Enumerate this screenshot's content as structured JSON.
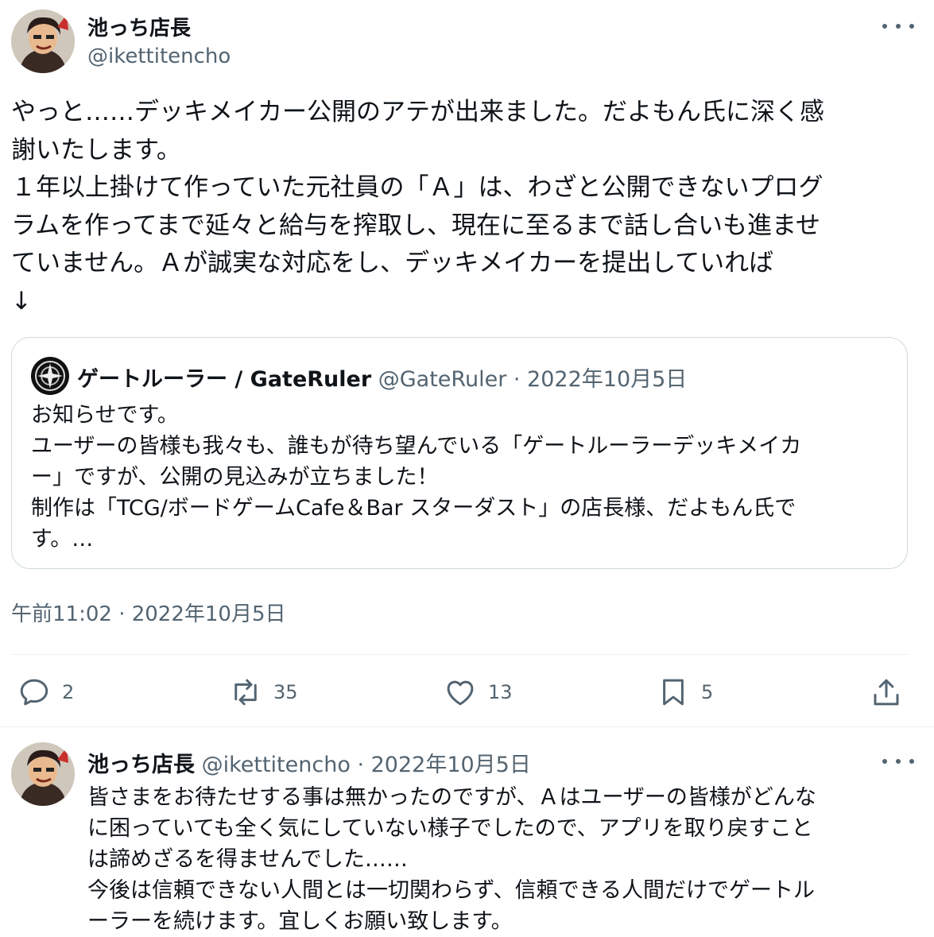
{
  "main_tweet": {
    "author_name": "池っち店長",
    "author_handle": "@ikettitencho",
    "text": "やっと……デッキメイカー公開のアテが出来ました。だよもん氏に深く感\n謝いたします。\n１年以上掛けて作っていた元社員の「Ａ」は、わざと公開できないプログ\nラムを作ってまで延々と給与を搾取し、現在に至るまで話し合いも進ませ\nていません。Ａが誠実な対応をし、デッキメイカーを提出していれば\n↓",
    "timestamp": "午前11:02 · 2022年10月5日"
  },
  "quoted_tweet": {
    "author_name": "ゲートルーラー / GateRuler",
    "author_handle": "@GateRuler",
    "date": "· 2022年10月5日",
    "text": "お知らせです。\nユーザーの皆様も我々も、誰もが待ち望んでいる「ゲートルーラーデッキメイカ\nー」ですが、公開の見込みが立ちました！\n制作は「TCG/ボードゲームCafe＆Bar スターダスト」の店長様、だよもん氏で\nす。…"
  },
  "actions": {
    "reply_count": "2",
    "retweet_count": "35",
    "like_count": "13",
    "bookmark_count": "5"
  },
  "reply_tweet": {
    "author_name": "池っち店長",
    "author_handle": "@ikettitencho",
    "date": "· 2022年10月5日",
    "text": "皆さまをお待たせする事は無かったのですが、Ａはユーザーの皆様がどんな\nに困っていても全く気にしていない様子でしたので、アプリを取り戻すこと\nは諦めざるを得ませんでした……\n今後は信頼できない人間とは一切関わらず、信頼できる人間だけでゲートル\nーラーを続けます。宜しくお願い致します。"
  },
  "icons": [
    "more-icon",
    "reply-icon",
    "retweet-icon",
    "like-icon",
    "bookmark-icon",
    "share-icon"
  ],
  "colors": {
    "text": "#0f1419",
    "secondary": "#536471",
    "border": "#cfd9de"
  }
}
